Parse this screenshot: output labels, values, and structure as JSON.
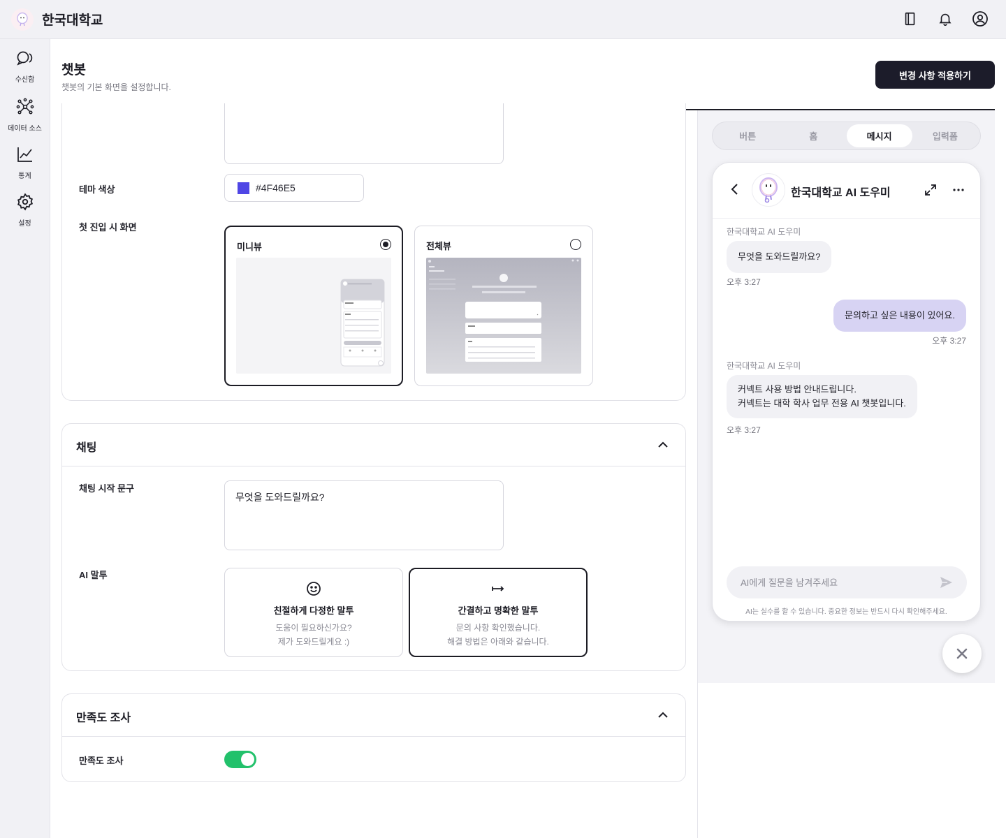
{
  "app": {
    "name": "한국대학교"
  },
  "topbar": {
    "icons": [
      "book-icon",
      "bell-icon",
      "user-circle-icon"
    ]
  },
  "sidebar": {
    "items": [
      {
        "label": "수신함",
        "icon": "inbox-chat-icon"
      },
      {
        "label": "데이터 소스",
        "icon": "network-icon"
      },
      {
        "label": "통계",
        "icon": "chart-line-icon"
      },
      {
        "label": "설정",
        "icon": "gear-icon"
      }
    ]
  },
  "header": {
    "title": "챗봇",
    "subtitle": "챗봇의 기본 화면을 설정합니다.",
    "apply_label": "변경 사항 적용하기"
  },
  "display": {
    "theme_color_label": "테마 색상",
    "theme_color_value": "#4F46E5",
    "entry_view_label": "첫 진입 시 화면",
    "views": [
      {
        "label": "미니뷰",
        "selected": true
      },
      {
        "label": "전체뷰",
        "selected": false
      }
    ]
  },
  "chat_section": {
    "title": "채팅",
    "start_phrase_label": "채팅 시작 문구",
    "start_phrase_value": "무엇을 도와드릴까요?",
    "tone_label": "AI 말투",
    "tones": [
      {
        "title": "친절하게 다정한 말투",
        "desc1": "도움이 필요하신가요?",
        "desc2": "제가 도와드릴게요 :)",
        "icon": "smile-icon",
        "selected": false
      },
      {
        "title": "간결하고 명확한 말투",
        "desc1": "문의 사항 확인했습니다.",
        "desc2": "해결 방법은 아래와 같습니다.",
        "icon": "arrow-line-icon",
        "selected": true
      }
    ]
  },
  "survey_section": {
    "title": "만족도 조사",
    "toggle_label": "만족도 조사",
    "enabled": true
  },
  "preview": {
    "tabs": [
      {
        "label": "버튼",
        "active": false
      },
      {
        "label": "홈",
        "active": false
      },
      {
        "label": "메시지",
        "active": true
      },
      {
        "label": "입력폼",
        "active": false
      }
    ],
    "bot_name": "한국대학교 AI 도우미",
    "messages": [
      {
        "from": "bot",
        "sender": "한국대학교 AI 도우미",
        "text": "무엇을 도와드릴까요?",
        "time": "오후 3:27"
      },
      {
        "from": "user",
        "text": "문의하고 싶은 내용이 있어요.",
        "time": "오후 3:27"
      },
      {
        "from": "bot",
        "sender": "한국대학교 AI 도우미",
        "line1": "커넥트 사용 방법 안내드립니다.",
        "line2": "커넥트는 대학 학사 업무 전용 AI 챗봇입니다.",
        "time": "오후 3:27"
      }
    ],
    "input_placeholder": "AI에게 질문을 남겨주세요",
    "disclaimer": "AI는 실수를 할 수 있습니다. 중요한 정보는 반드시 다시 확인해주세요."
  },
  "colors": {
    "accent": "#4F46E5",
    "toggle_on": "#22c16b",
    "user_bubble": "#d7d3f3",
    "primary_button": "#1c1c2a"
  }
}
